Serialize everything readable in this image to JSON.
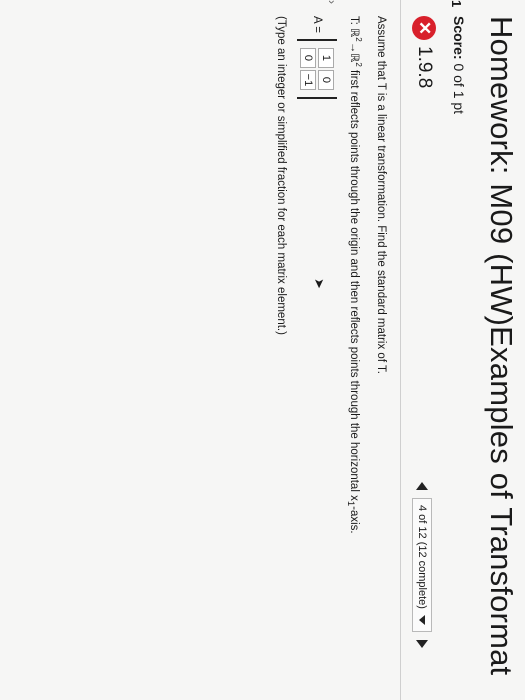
{
  "header": {
    "title": "Homework: M09 (HW)Examples of Transformat",
    "score_label": "Score:",
    "score_value": "0 of 1 pt"
  },
  "question": {
    "number": "1.9.8",
    "status_icon": "x-incorrect-icon",
    "progress_text": "4 of 12 (12 complete)",
    "prompt": "Assume that T is a linear transformation. Find the standard matrix of T.",
    "line2_prefix": "T: ℝ",
    "line2_mid": "→ℝ",
    "line2_exp": "2",
    "line2_suffix": "first reflects points through the origin and then reflects points through the horizontal x",
    "line2_sub": "1",
    "line2_end": "-axis.",
    "matrix_label": "A =",
    "matrix": [
      "1",
      "0",
      "0",
      "−1"
    ],
    "hint": "(Type an integer or simplified fraction for each matrix element.)"
  },
  "colors": {
    "incorrect": "#d8202b"
  }
}
